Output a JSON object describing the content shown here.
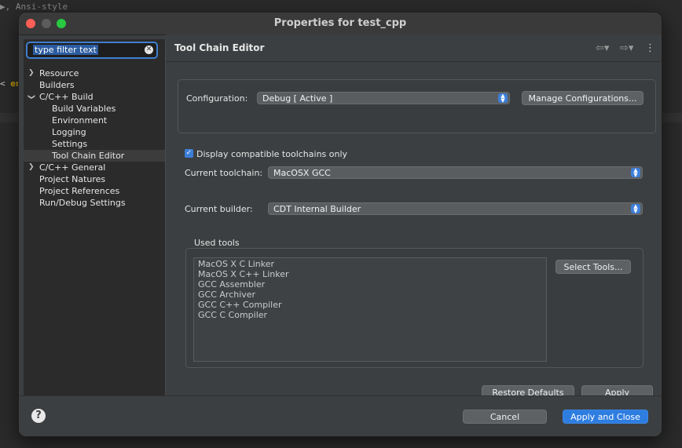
{
  "background": {
    "code_line_1": "▶, Ansi-style",
    "code_line_2_prefix": "<",
    "code_line_2_keyword": "en"
  },
  "window": {
    "title": "Properties for test_cpp"
  },
  "sidebar": {
    "filter_text": "type filter text",
    "items": [
      {
        "label": "Resource",
        "expandable": true,
        "expanded": false
      },
      {
        "label": "Builders",
        "expandable": false
      },
      {
        "label": "C/C++ Build",
        "expandable": true,
        "expanded": true
      },
      {
        "label": "Build Variables",
        "expandable": false
      },
      {
        "label": "Environment",
        "expandable": false
      },
      {
        "label": "Logging",
        "expandable": false
      },
      {
        "label": "Settings",
        "expandable": false
      },
      {
        "label": "Tool Chain Editor",
        "expandable": false,
        "selected": true
      },
      {
        "label": "C/C++ General",
        "expandable": true,
        "expanded": false
      },
      {
        "label": "Project Natures",
        "expandable": false
      },
      {
        "label": "Project References",
        "expandable": false
      },
      {
        "label": "Run/Debug Settings",
        "expandable": false
      }
    ]
  },
  "page": {
    "title": "Tool Chain Editor",
    "back_icon": "arrow-left-icon",
    "forward_icon": "arrow-right-icon",
    "more_icon": "vertical-ellipsis-icon"
  },
  "config": {
    "label": "Configuration:",
    "value": "Debug  [ Active ]",
    "manage_button": "Manage Configurations..."
  },
  "toolchain": {
    "compat_checkbox_label": "Display compatible toolchains only",
    "compat_checked": true,
    "current_toolchain_label": "Current toolchain:",
    "current_toolchain_value": "MacOSX GCC",
    "current_builder_label": "Current builder:",
    "current_builder_value": "CDT Internal Builder"
  },
  "used_tools": {
    "label": "Used tools",
    "items": [
      "MacOS X C Linker",
      "MacOS X C++ Linker",
      "GCC Assembler",
      "GCC Archiver",
      "GCC C++ Compiler",
      "GCC C Compiler"
    ],
    "select_button": "Select Tools..."
  },
  "actions": {
    "restore_defaults": "Restore Defaults",
    "apply": "Apply",
    "cancel": "Cancel",
    "apply_and_close": "Apply and Close",
    "help_icon": "help-icon"
  },
  "colors": {
    "accent": "#2e7de0",
    "close": "#ff5f57",
    "maximize": "#28c840"
  }
}
